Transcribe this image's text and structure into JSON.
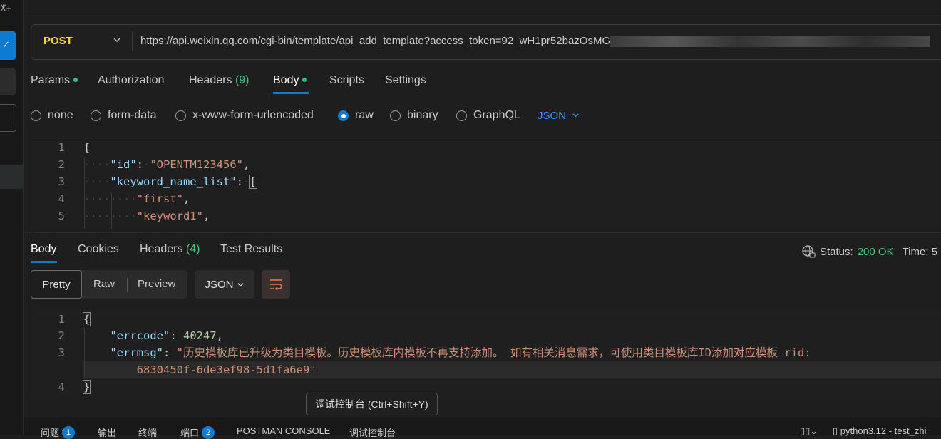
{
  "request": {
    "method": "POST",
    "url": "https://api.weixin.qq.com/cgi-bin/template/api_add_template?access_token=92_wH1pr52bazOsMG"
  },
  "request_tabs": [
    {
      "label": "Params"
    },
    {
      "label": "Authorization"
    },
    {
      "label": "Headers",
      "count": "(9)"
    },
    {
      "label": "Body"
    },
    {
      "label": "Scripts"
    },
    {
      "label": "Settings"
    }
  ],
  "body_types": [
    "none",
    "form-data",
    "x-www-form-urlencoded",
    "raw",
    "binary",
    "GraphQL"
  ],
  "body_format": "JSON",
  "request_body": {
    "line_numbers": [
      "1",
      "2",
      "3",
      "4",
      "5"
    ],
    "open_brace": "{",
    "id_key": "\"id\"",
    "id_value": "\"OPENTM123456\"",
    "list_key": "\"keyword_name_list\"",
    "open_bracket": "[",
    "item1": "\"first\"",
    "item2": "\"keyword1\""
  },
  "response_tabs": [
    {
      "label": "Body"
    },
    {
      "label": "Cookies"
    },
    {
      "label": "Headers",
      "count": "(4)"
    },
    {
      "label": "Test Results"
    }
  ],
  "status": {
    "label": "Status:",
    "value": "200 OK",
    "time_label": "Time: 5"
  },
  "view_modes": [
    "Pretty",
    "Raw",
    "Preview"
  ],
  "response_format": "JSON",
  "response_body": {
    "line_numbers": [
      "1",
      "2",
      "3",
      "",
      "4"
    ],
    "open_brace": "{",
    "errcode_key": "\"errcode\"",
    "errcode_value": "40247",
    "errmsg_key": "\"errmsg\"",
    "errmsg_value": "\"历史模板库已升级为类目模板。历史模板库内模板不再支持添加。 如有相关消息需求，可使用类目模板库ID添加对应模板 rid:",
    "errmsg_cont": "6830450f-6de3ef98-5d1fa6e9\"",
    "close_brace": "}"
  },
  "tooltip": "调试控制台 (Ctrl+Shift+Y)",
  "bottom_tabs": [
    {
      "label": "问题",
      "badge": "1"
    },
    {
      "label": "输出"
    },
    {
      "label": "终端"
    },
    {
      "label": "端口",
      "badge": "2"
    },
    {
      "label": "POSTMAN CONSOLE"
    },
    {
      "label": "调试控制台"
    }
  ],
  "bottom_right": {
    "interpreter": "python3.12 - test_zhi"
  },
  "colors": {
    "accent": "#0e7ad1",
    "method": "#f5d547",
    "ok": "#4ec27b"
  }
}
